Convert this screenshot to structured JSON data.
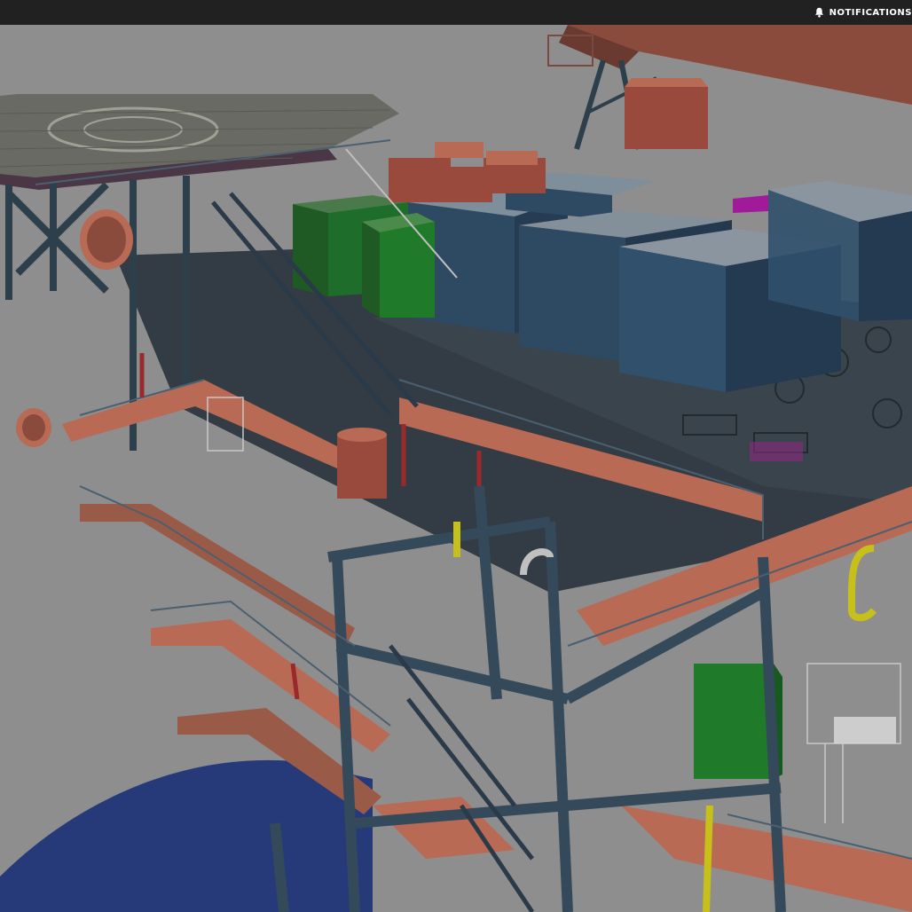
{
  "topbar": {
    "notifications_label": "NOTIFICATIONS",
    "notifications_icon": "bell-icon"
  },
  "viewport": {
    "scene": "3d-model-viewer",
    "colors": {
      "background": "#8e8e8e",
      "structure": "#2e3f4c",
      "deck_orange": "#b86a55",
      "module_blue": "#2e4a63",
      "module_green": "#1f6d2a",
      "accent_magenta": "#a01a9a",
      "pipe_yellow": "#c8c01a",
      "sea_blue": "#263a7a"
    }
  }
}
